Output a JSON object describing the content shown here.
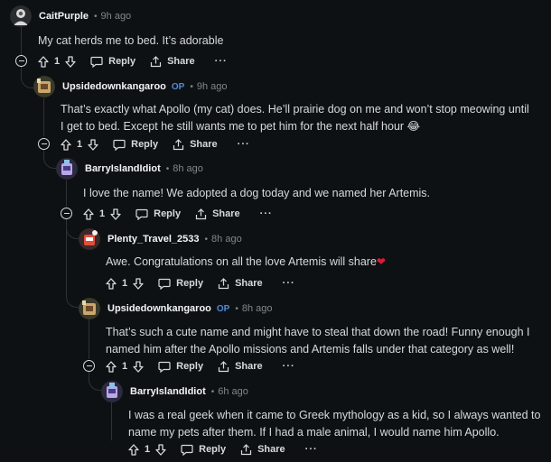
{
  "labels": {
    "reply": "Reply",
    "share": "Share",
    "more": "···",
    "op": "OP",
    "sep": "•"
  },
  "comments": [
    {
      "author": "CaitPurple",
      "time": "9h ago",
      "op": false,
      "text": "My cat herds me to bed. It’s adorable",
      "votes": "1"
    },
    {
      "author": "Upsidedownkangaroo",
      "time": "9h ago",
      "op": true,
      "text": "That’s exactly what Apollo (my cat) does. He’ll prairie dog on me and won’t stop meowing until I get to bed. Except he still wants me to pet him for the next half hour 😂",
      "votes": "1"
    },
    {
      "author": "BarryIslandIdiot",
      "time": "8h ago",
      "op": false,
      "text": "I love the name! We adopted a dog today and we named her Artemis.",
      "votes": "1"
    },
    {
      "author": "Plenty_Travel_2533",
      "time": "8h ago",
      "op": false,
      "text": "Awe. Congratulations on all the love Artemis will share",
      "votes": "1"
    },
    {
      "author": "Upsidedownkangaroo",
      "time": "8h ago",
      "op": true,
      "text": "That’s such a cute name and might have to steal that down the road! Funny enough I named him after the Apollo missions and Artemis falls under that category as well!",
      "votes": "1"
    },
    {
      "author": "BarryIslandIdiot",
      "time": "6h ago",
      "op": false,
      "text": "I was a real geek when it came to Greek mythology as a kid, so I always wanted to name my pets after them. If I had a male animal, I would name him Apollo.",
      "votes": "1"
    }
  ],
  "colors": {
    "background": "#0e1113",
    "thread_line": "#2e3234",
    "op": "#4f8bd8",
    "heart": "#e0183a"
  }
}
